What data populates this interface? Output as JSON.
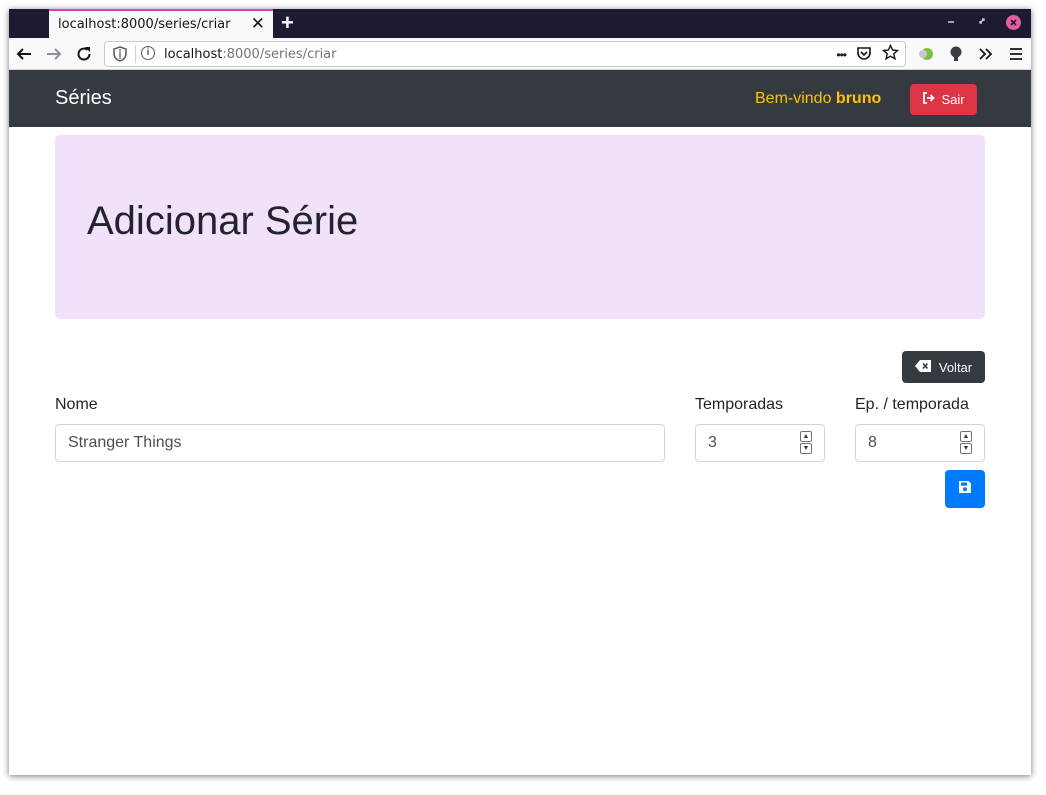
{
  "browser": {
    "tab_title": "localhost:8000/series/criar",
    "tab_close": "✕",
    "new_tab": "+",
    "url_host": "localhost",
    "url_path": ":8000/series/criar",
    "more_actions": "•••"
  },
  "navbar": {
    "brand": "Séries",
    "welcome_prefix": "Bem-vindo ",
    "username": "bruno",
    "logout_label": "Sair"
  },
  "header": {
    "title": "Adicionar Série"
  },
  "actions": {
    "back_label": "Voltar"
  },
  "form": {
    "name_label": "Nome",
    "name_value": "Stranger Things",
    "seasons_label": "Temporadas",
    "seasons_value": "3",
    "episodes_label": "Ep. / temporada",
    "episodes_value": "8"
  },
  "colors": {
    "navbar_bg": "#343a40",
    "jumbotron_bg": "#f2e1fb",
    "danger": "#dc3545",
    "primary": "#007bff",
    "warning": "#ffc107"
  }
}
